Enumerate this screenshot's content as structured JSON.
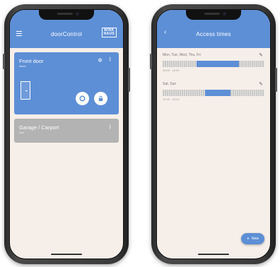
{
  "left_screen": {
    "title": "doorControl",
    "logo": "WINK HAUS",
    "doors": [
      {
        "name": "Front door",
        "role": "Admin",
        "color": "#5d8fd6"
      },
      {
        "name": "Garage / Carport",
        "role": "User",
        "color": "#b3b3b3"
      }
    ],
    "icons": [
      "menu-icon",
      "gear-icon",
      "bluetooth-icon",
      "door-icon",
      "open-icon",
      "lock-icon"
    ]
  },
  "right_screen": {
    "title": "Access times",
    "entries": [
      {
        "days": "Mon, Tue, Wed, Thu, Fri",
        "range": "08:00 - 18:00",
        "start_fraction": 0.33,
        "end_fraction": 0.75
      },
      {
        "days": "Sat, Sun",
        "range": "10:00 - 16:00",
        "start_fraction": 0.42,
        "end_fraction": 0.67
      }
    ],
    "fab_label": "New"
  },
  "colors": {
    "accent": "#5d8fd6",
    "inactive": "#b3b3b3",
    "background": "#f6efe9"
  }
}
